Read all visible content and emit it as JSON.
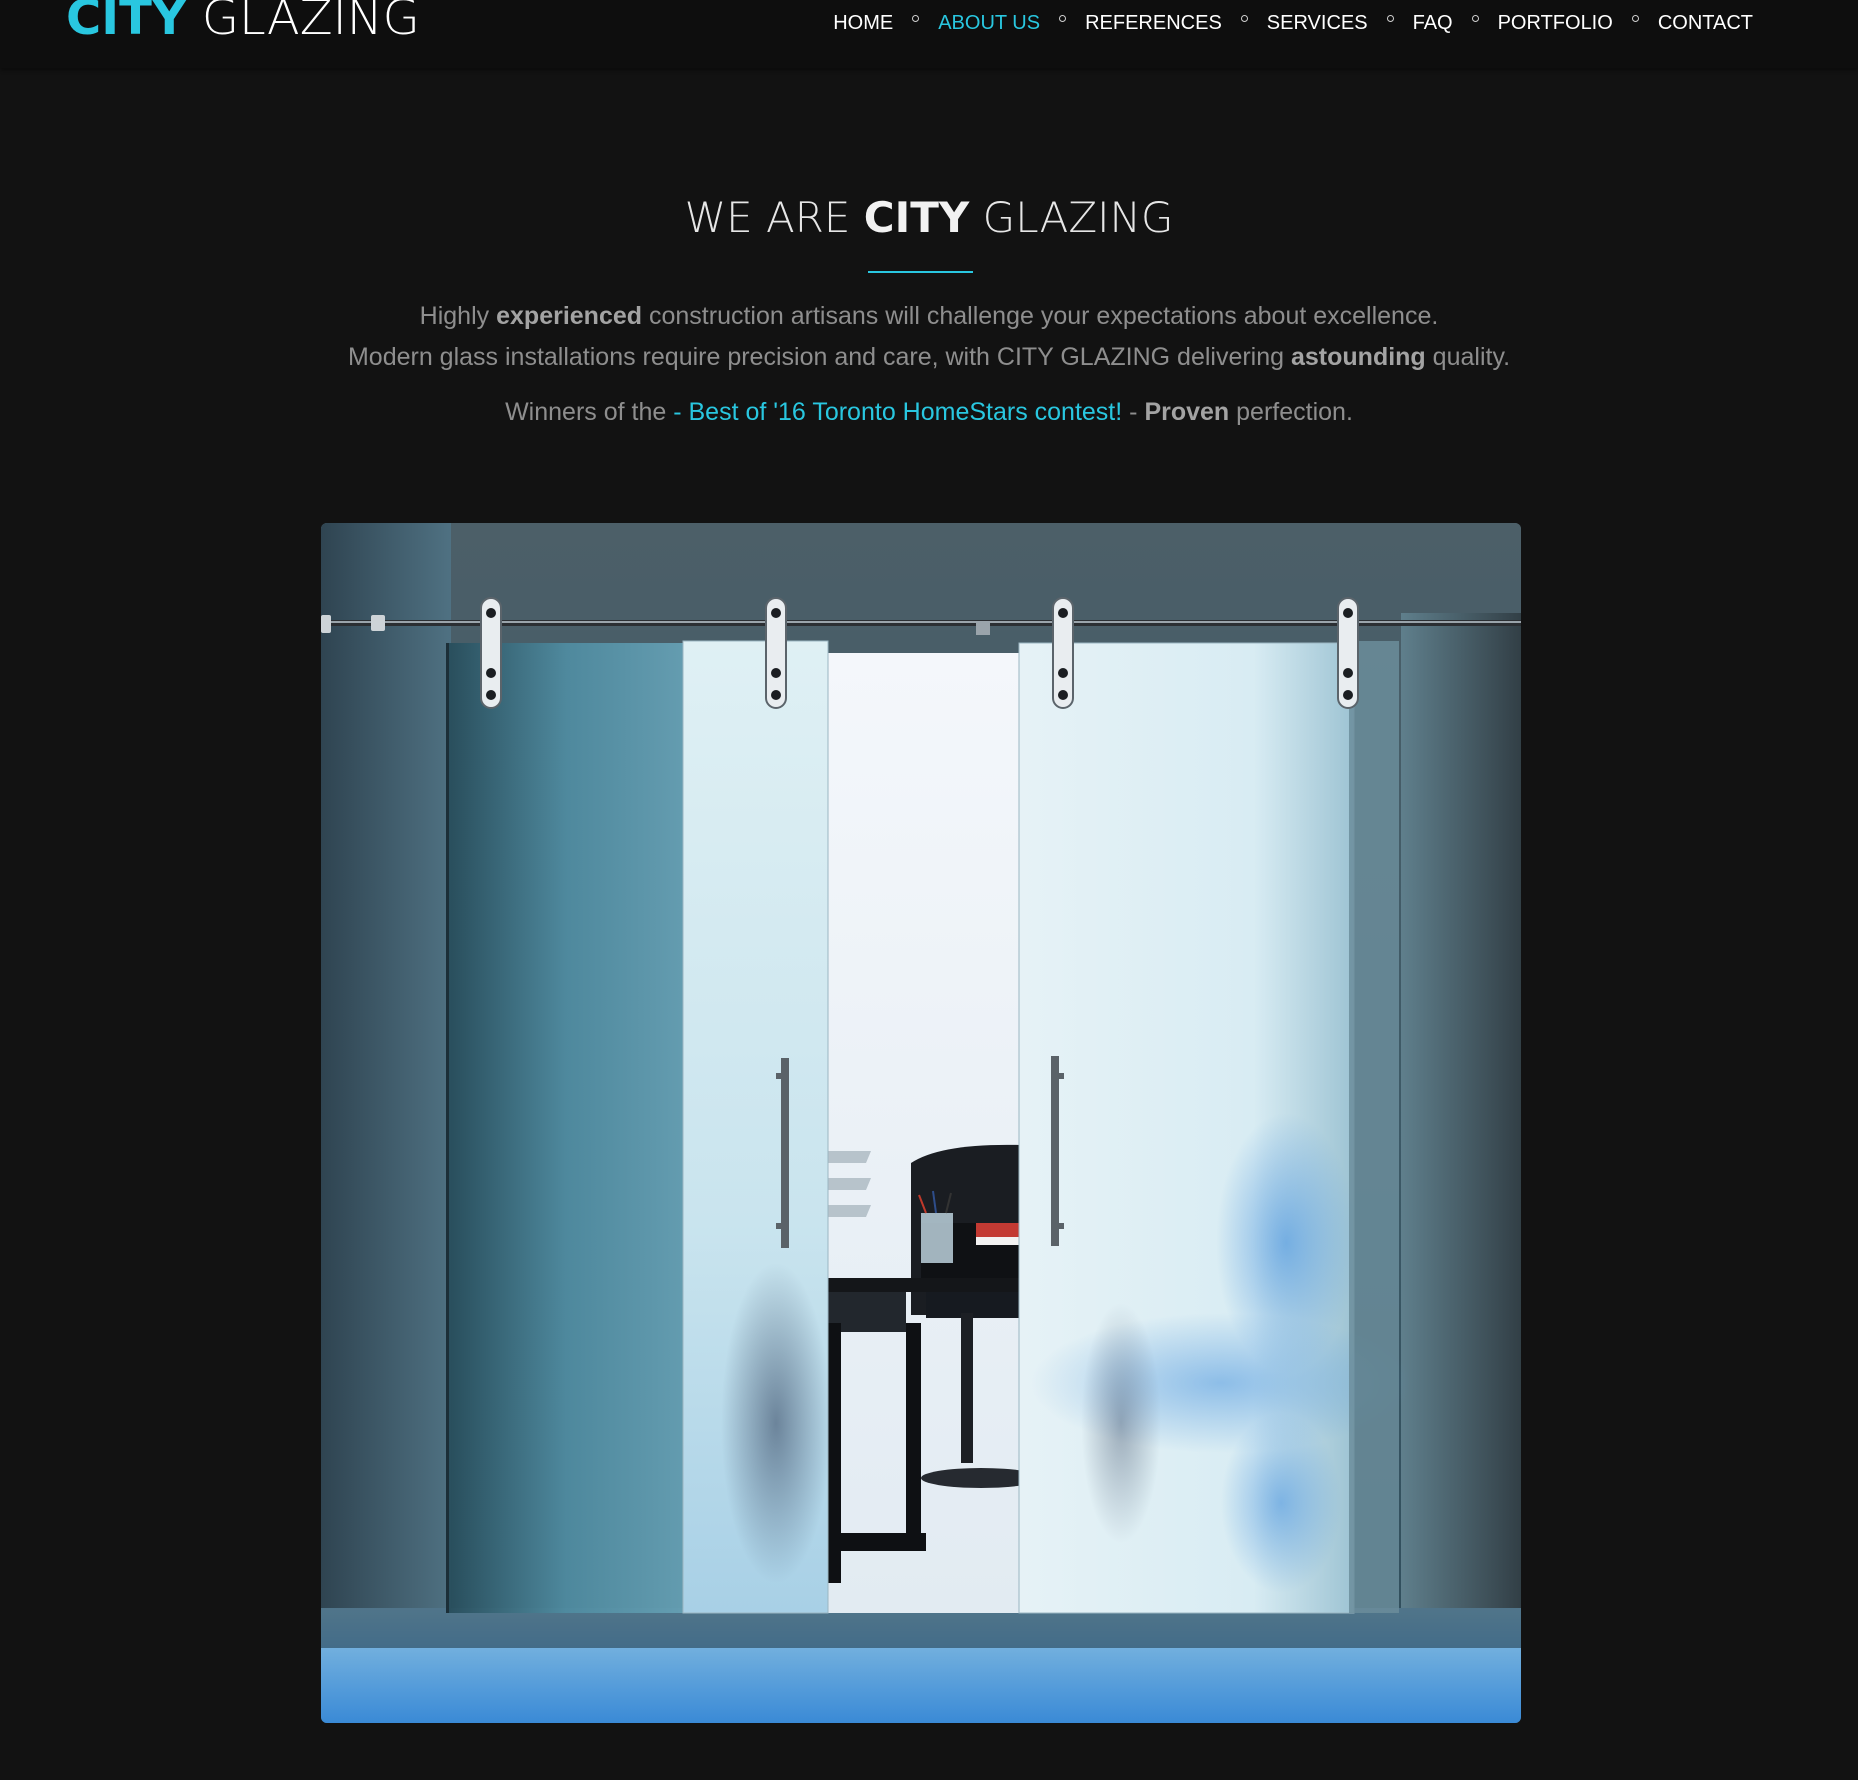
{
  "header": {
    "logo": {
      "accent": "CITY",
      "rest": "GLAZING"
    },
    "nav": [
      {
        "label": "HOME",
        "active": false
      },
      {
        "label": "ABOUT US",
        "active": true
      },
      {
        "label": "REFERENCES",
        "active": false
      },
      {
        "label": "SERVICES",
        "active": false
      },
      {
        "label": "FAQ",
        "active": false
      },
      {
        "label": "PORTFOLIO",
        "active": false
      },
      {
        "label": "CONTACT",
        "active": false
      }
    ]
  },
  "about": {
    "title": {
      "pre": "WE ARE",
      "strong": "CITY",
      "post": "GLAZING"
    },
    "line1": {
      "pre": "Highly",
      "strong": "experienced",
      "post": "construction artisans will challenge your expectations about excellence."
    },
    "line2": {
      "pre": "Modern glass installations require precision and care, with CITY GLAZING delivering",
      "strong": "astounding",
      "post": "quality."
    },
    "line3": {
      "pre": "Winners of the",
      "accent": "- Best of '16 Toronto HomeStars contest!",
      "mid": "-",
      "strong": "Proven",
      "post": "perfection."
    }
  },
  "colors": {
    "accent": "#29c7e0",
    "background": "#121212",
    "header_background": "#0e0e0e",
    "body_text": "#8e8e8e"
  }
}
